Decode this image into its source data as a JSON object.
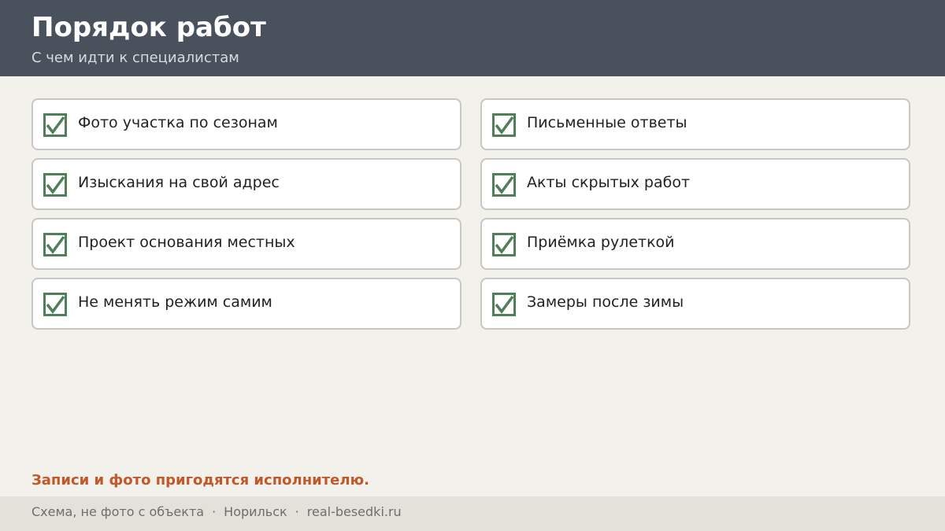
{
  "header": {
    "title": "Порядок работ",
    "subtitle": "С чем идти к специалистам"
  },
  "colors": {
    "header_bg": "#48515c",
    "check": "#4f7f58",
    "accent": "#c0582a"
  },
  "checklist": {
    "left": [
      {
        "label": "Фото участка по сезонам",
        "icon": "checkbox-checked-icon"
      },
      {
        "label": "Изыскания на свой адрес",
        "icon": "checkbox-checked-icon"
      },
      {
        "label": "Проект основания местных",
        "icon": "checkbox-checked-icon"
      },
      {
        "label": "Не менять режим самим",
        "icon": "checkbox-checked-icon"
      }
    ],
    "right": [
      {
        "label": "Письменные ответы",
        "icon": "checkbox-checked-icon"
      },
      {
        "label": "Акты скрытых работ",
        "icon": "checkbox-checked-icon"
      },
      {
        "label": "Приёмка рулеткой",
        "icon": "checkbox-checked-icon"
      },
      {
        "label": "Замеры после зимы",
        "icon": "checkbox-checked-icon"
      }
    ]
  },
  "note": "Записи и фото пригодятся исполнителю.",
  "footer": {
    "caption": "Схема, не фото с объекта",
    "city": "Норильск",
    "site": "real-besedki.ru",
    "separator": "·"
  }
}
